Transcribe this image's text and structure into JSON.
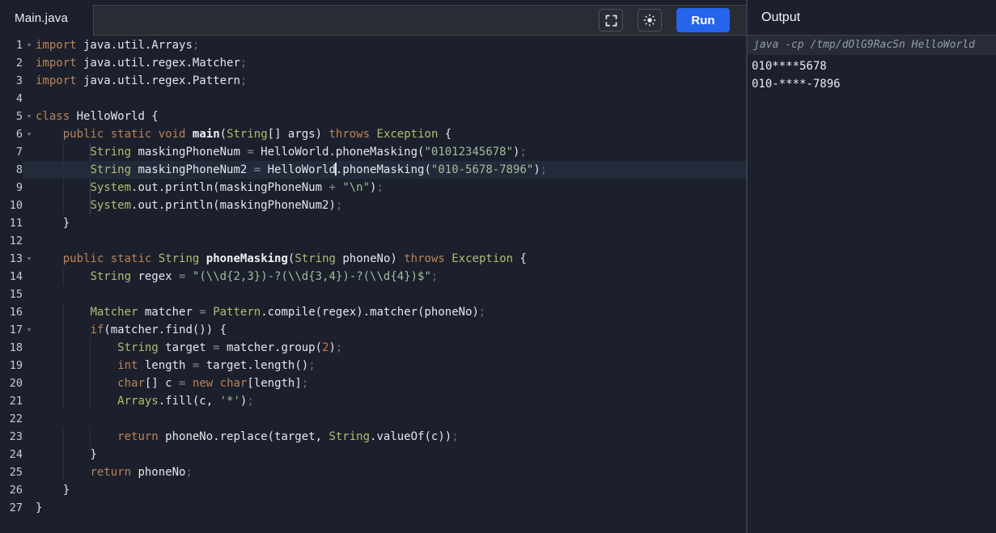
{
  "colors": {
    "accent": "#2564eb",
    "keyword": "#bd8354",
    "type": "#b4bc6e",
    "plain": "#e3e6ec",
    "string": "#a3bd9b",
    "number": "#d26e50",
    "operator": "#7f8a9d",
    "punctuation": "#667084"
  },
  "header": {
    "tab": "Main.java",
    "run_label": "Run"
  },
  "icons": {
    "fold": "▾"
  },
  "output": {
    "title": "Output",
    "command": "java -cp /tmp/dOlG9RacSn HelloWorld",
    "lines": [
      "010****5678",
      "010-****-7896"
    ]
  },
  "editor": {
    "language": "java",
    "current_line": 8,
    "lines": [
      {
        "n": 1,
        "fold": true,
        "tokens": [
          [
            "kw",
            "import"
          ],
          [
            "pl",
            " java.util.Arrays"
          ],
          [
            "pu",
            ";"
          ]
        ]
      },
      {
        "n": 2,
        "tokens": [
          [
            "kw",
            "import"
          ],
          [
            "pl",
            " java.util.regex.Matcher"
          ],
          [
            "pu",
            ";"
          ]
        ]
      },
      {
        "n": 3,
        "tokens": [
          [
            "kw",
            "import"
          ],
          [
            "pl",
            " java.util.regex.Pattern"
          ],
          [
            "pu",
            ";"
          ]
        ]
      },
      {
        "n": 4,
        "tokens": []
      },
      {
        "n": 5,
        "fold": true,
        "tokens": [
          [
            "kw",
            "class"
          ],
          [
            "pl",
            " HelloWorld {"
          ]
        ]
      },
      {
        "n": 6,
        "fold": true,
        "tokens": [
          [
            "pl",
            "    "
          ],
          [
            "kw",
            "public"
          ],
          [
            "pl",
            " "
          ],
          [
            "kw",
            "static"
          ],
          [
            "pl",
            " "
          ],
          [
            "kw",
            "void"
          ],
          [
            "pl",
            " "
          ],
          [
            "fn",
            "main"
          ],
          [
            "pl",
            "("
          ],
          [
            "ty",
            "String"
          ],
          [
            "pl",
            "[] args) "
          ],
          [
            "kw",
            "throws"
          ],
          [
            "pl",
            " "
          ],
          [
            "ty",
            "Exception"
          ],
          [
            "pl",
            " {"
          ]
        ]
      },
      {
        "n": 7,
        "ag": 8,
        "tokens": [
          [
            "pl",
            "        "
          ],
          [
            "ty",
            "String"
          ],
          [
            "pl",
            " maskingPhoneNum "
          ],
          [
            "op",
            "="
          ],
          [
            "pl",
            " HelloWorld.phoneMasking("
          ],
          [
            "st",
            "\"01012345678\""
          ],
          [
            "pl",
            ")"
          ],
          [
            "pu",
            ";"
          ]
        ]
      },
      {
        "n": 8,
        "tokens": [
          [
            "pl",
            "        "
          ],
          [
            "ty",
            "String"
          ],
          [
            "pl",
            " maskingPhoneNum2 "
          ],
          [
            "op",
            "="
          ],
          [
            "pl",
            " HelloWorld"
          ],
          [
            "cur",
            ""
          ],
          [
            "pl",
            ".phoneMasking("
          ],
          [
            "st",
            "\"010-5678-7896\""
          ],
          [
            "pl",
            ")"
          ],
          [
            "pu",
            ";"
          ]
        ]
      },
      {
        "n": 9,
        "ag": 8,
        "tokens": [
          [
            "pl",
            "        "
          ],
          [
            "ty",
            "System"
          ],
          [
            "pl",
            ".out.println(maskingPhoneNum "
          ],
          [
            "op",
            "+"
          ],
          [
            "pl",
            " "
          ],
          [
            "st",
            "\"\\n\""
          ],
          [
            "pl",
            ")"
          ],
          [
            "pu",
            ";"
          ]
        ]
      },
      {
        "n": 10,
        "ag": 8,
        "tokens": [
          [
            "pl",
            "        "
          ],
          [
            "ty",
            "System"
          ],
          [
            "pl",
            ".out.println(maskingPhoneNum2)"
          ],
          [
            "pu",
            ";"
          ]
        ]
      },
      {
        "n": 11,
        "tokens": [
          [
            "pl",
            "    }"
          ]
        ]
      },
      {
        "n": 12,
        "tokens": []
      },
      {
        "n": 13,
        "fold": true,
        "tokens": [
          [
            "pl",
            "    "
          ],
          [
            "kw",
            "public"
          ],
          [
            "pl",
            " "
          ],
          [
            "kw",
            "static"
          ],
          [
            "pl",
            " "
          ],
          [
            "ty",
            "String"
          ],
          [
            "pl",
            " "
          ],
          [
            "fn",
            "phoneMasking"
          ],
          [
            "pl",
            "("
          ],
          [
            "ty",
            "String"
          ],
          [
            "pl",
            " phoneNo) "
          ],
          [
            "kw",
            "throws"
          ],
          [
            "pl",
            " "
          ],
          [
            "ty",
            "Exception"
          ],
          [
            "pl",
            " {"
          ]
        ]
      },
      {
        "n": 14,
        "tokens": [
          [
            "pl",
            "        "
          ],
          [
            "ty",
            "String"
          ],
          [
            "pl",
            " regex "
          ],
          [
            "op",
            "="
          ],
          [
            "pl",
            " "
          ],
          [
            "st",
            "\"(\\\\d{2,3})-?(\\\\d{3,4})-?(\\\\d{4})$\""
          ],
          [
            "pu",
            ";"
          ]
        ]
      },
      {
        "n": 15,
        "tokens": []
      },
      {
        "n": 16,
        "tokens": [
          [
            "pl",
            "        "
          ],
          [
            "ty",
            "Matcher"
          ],
          [
            "pl",
            " matcher "
          ],
          [
            "op",
            "="
          ],
          [
            "pl",
            " "
          ],
          [
            "ty",
            "Pattern"
          ],
          [
            "pl",
            ".compile(regex).matcher(phoneNo)"
          ],
          [
            "pu",
            ";"
          ]
        ]
      },
      {
        "n": 17,
        "fold": true,
        "tokens": [
          [
            "pl",
            "        "
          ],
          [
            "kw",
            "if"
          ],
          [
            "pl",
            "(matcher.find()) {"
          ]
        ]
      },
      {
        "n": 18,
        "tokens": [
          [
            "pl",
            "            "
          ],
          [
            "ty",
            "String"
          ],
          [
            "pl",
            " target "
          ],
          [
            "op",
            "="
          ],
          [
            "pl",
            " matcher.group("
          ],
          [
            "nu",
            "2"
          ],
          [
            "pl",
            ")"
          ],
          [
            "pu",
            ";"
          ]
        ]
      },
      {
        "n": 19,
        "tokens": [
          [
            "pl",
            "            "
          ],
          [
            "kw",
            "int"
          ],
          [
            "pl",
            " length "
          ],
          [
            "op",
            "="
          ],
          [
            "pl",
            " target.length()"
          ],
          [
            "pu",
            ";"
          ]
        ]
      },
      {
        "n": 20,
        "tokens": [
          [
            "pl",
            "            "
          ],
          [
            "kw",
            "char"
          ],
          [
            "pl",
            "[] c "
          ],
          [
            "op",
            "="
          ],
          [
            "pl",
            " "
          ],
          [
            "kw",
            "new"
          ],
          [
            "pl",
            " "
          ],
          [
            "kw",
            "char"
          ],
          [
            "pl",
            "[length]"
          ],
          [
            "pu",
            ";"
          ]
        ]
      },
      {
        "n": 21,
        "tokens": [
          [
            "pl",
            "            "
          ],
          [
            "ty",
            "Arrays"
          ],
          [
            "pl",
            ".fill(c, "
          ],
          [
            "st",
            "'*'"
          ],
          [
            "pl",
            ")"
          ],
          [
            "pu",
            ";"
          ]
        ]
      },
      {
        "n": 22,
        "tokens": []
      },
      {
        "n": 23,
        "tokens": [
          [
            "pl",
            "            "
          ],
          [
            "kw",
            "return"
          ],
          [
            "pl",
            " phoneNo.replace(target, "
          ],
          [
            "ty",
            "String"
          ],
          [
            "pl",
            ".valueOf(c))"
          ],
          [
            "pu",
            ";"
          ]
        ]
      },
      {
        "n": 24,
        "tokens": [
          [
            "pl",
            "        }"
          ]
        ]
      },
      {
        "n": 25,
        "tokens": [
          [
            "pl",
            "        "
          ],
          [
            "kw",
            "return"
          ],
          [
            "pl",
            " phoneNo"
          ],
          [
            "pu",
            ";"
          ]
        ]
      },
      {
        "n": 26,
        "tokens": [
          [
            "pl",
            "    }"
          ]
        ]
      },
      {
        "n": 27,
        "tokens": [
          [
            "pl",
            "}"
          ]
        ]
      }
    ]
  }
}
